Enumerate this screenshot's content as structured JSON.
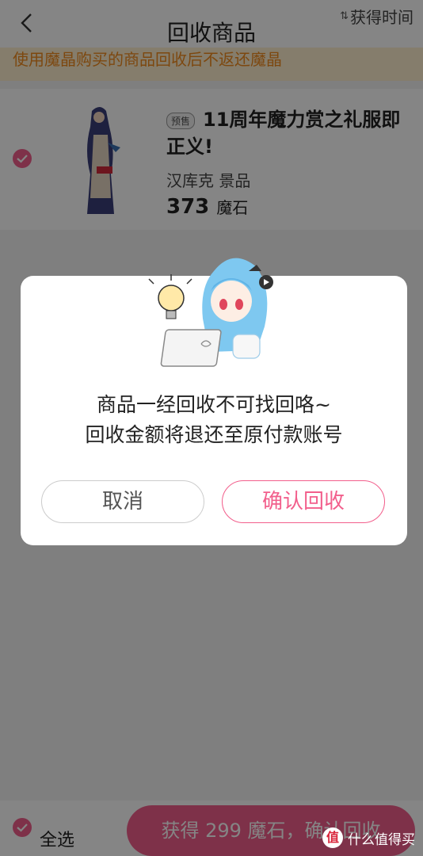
{
  "header": {
    "title": "回收商品",
    "sort_label": "获得时间",
    "sort_icon": "sort-icon"
  },
  "notice": {
    "text": "使用魔晶购买的商品回收后不返还魔晶"
  },
  "item": {
    "tag": "预售",
    "title": "11周年魔力赏之礼服即正义!",
    "subtitle": "汉库克 景品",
    "price": "373",
    "price_unit": "魔石",
    "checked": true
  },
  "bottom": {
    "select_all": "全选",
    "confirm": "获得 299 魔石，确认回收"
  },
  "dialog": {
    "line1": "商品一经回收不可找回咯~",
    "line2": "回收金额将退还至原付款账号",
    "cancel": "取消",
    "confirm": "确认回收"
  },
  "watermark": {
    "badge": "值",
    "text": "什么值得买"
  },
  "colors": {
    "accent": "#f25f8c",
    "notice_text": "#f08a1e",
    "notice_bg": "#fff0cf"
  }
}
